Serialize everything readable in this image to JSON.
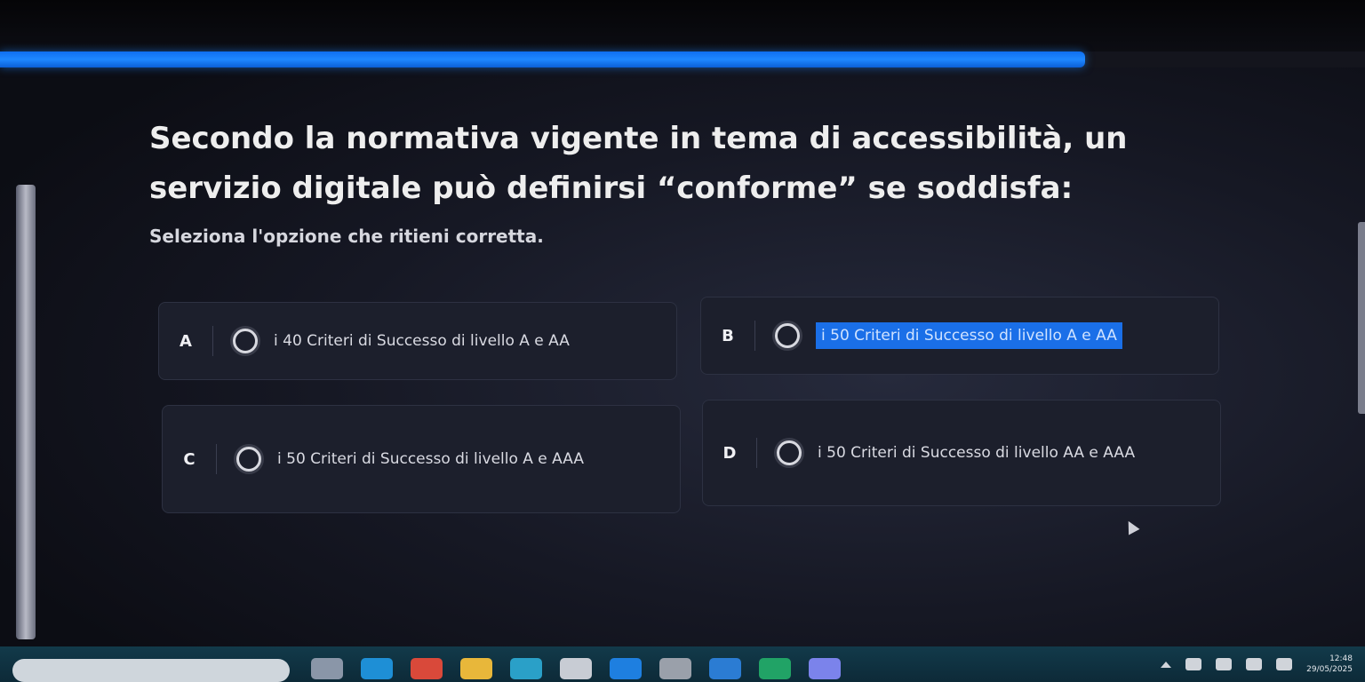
{
  "progress": {
    "fraction": 0.795,
    "color": "#1e88ff"
  },
  "question": {
    "text": "Secondo la normativa vigente in tema di accessibilità, un servizio digitale può definirsi “conforme” se soddisfa:",
    "instruction": "Seleziona l'opzione che ritieni corretta."
  },
  "options": [
    {
      "letter": "A",
      "text": "i 40 Criteri di Successo di livello A e AA",
      "selected": false
    },
    {
      "letter": "B",
      "text": "i 50 Criteri di Successo di livello A e AA",
      "selected": true
    },
    {
      "letter": "C",
      "text": "i 50 Criteri di Successo di livello A e AAA",
      "selected": false
    },
    {
      "letter": "D",
      "text": "i 50 Criteri di Successo di livello AA e AAA",
      "selected": false
    }
  ],
  "taskbar": {
    "apps": [
      {
        "icon": "widgets-icon",
        "color": "#8a96a8"
      },
      {
        "icon": "edge-icon",
        "color": "#1e8fd6"
      },
      {
        "icon": "chrome-icon",
        "color": "#d9493a"
      },
      {
        "icon": "file-explorer-icon",
        "color": "#e8b73a"
      },
      {
        "icon": "store-icon",
        "color": "#2aa0c8"
      },
      {
        "icon": "calculator-icon",
        "color": "#c8ccd4"
      },
      {
        "icon": "mail-icon",
        "color": "#1e7fe0"
      },
      {
        "icon": "camera-icon",
        "color": "#9aa0aa"
      },
      {
        "icon": "word-icon",
        "color": "#2b7cd3"
      },
      {
        "icon": "excel-icon",
        "color": "#21a366"
      },
      {
        "icon": "teams-icon",
        "color": "#7b83eb"
      }
    ],
    "tray_icons": [
      "chevron-up-icon",
      "onedrive-icon",
      "wifi-icon",
      "volume-icon",
      "battery-icon"
    ],
    "time": "12:48",
    "date": "29/05/2025"
  }
}
